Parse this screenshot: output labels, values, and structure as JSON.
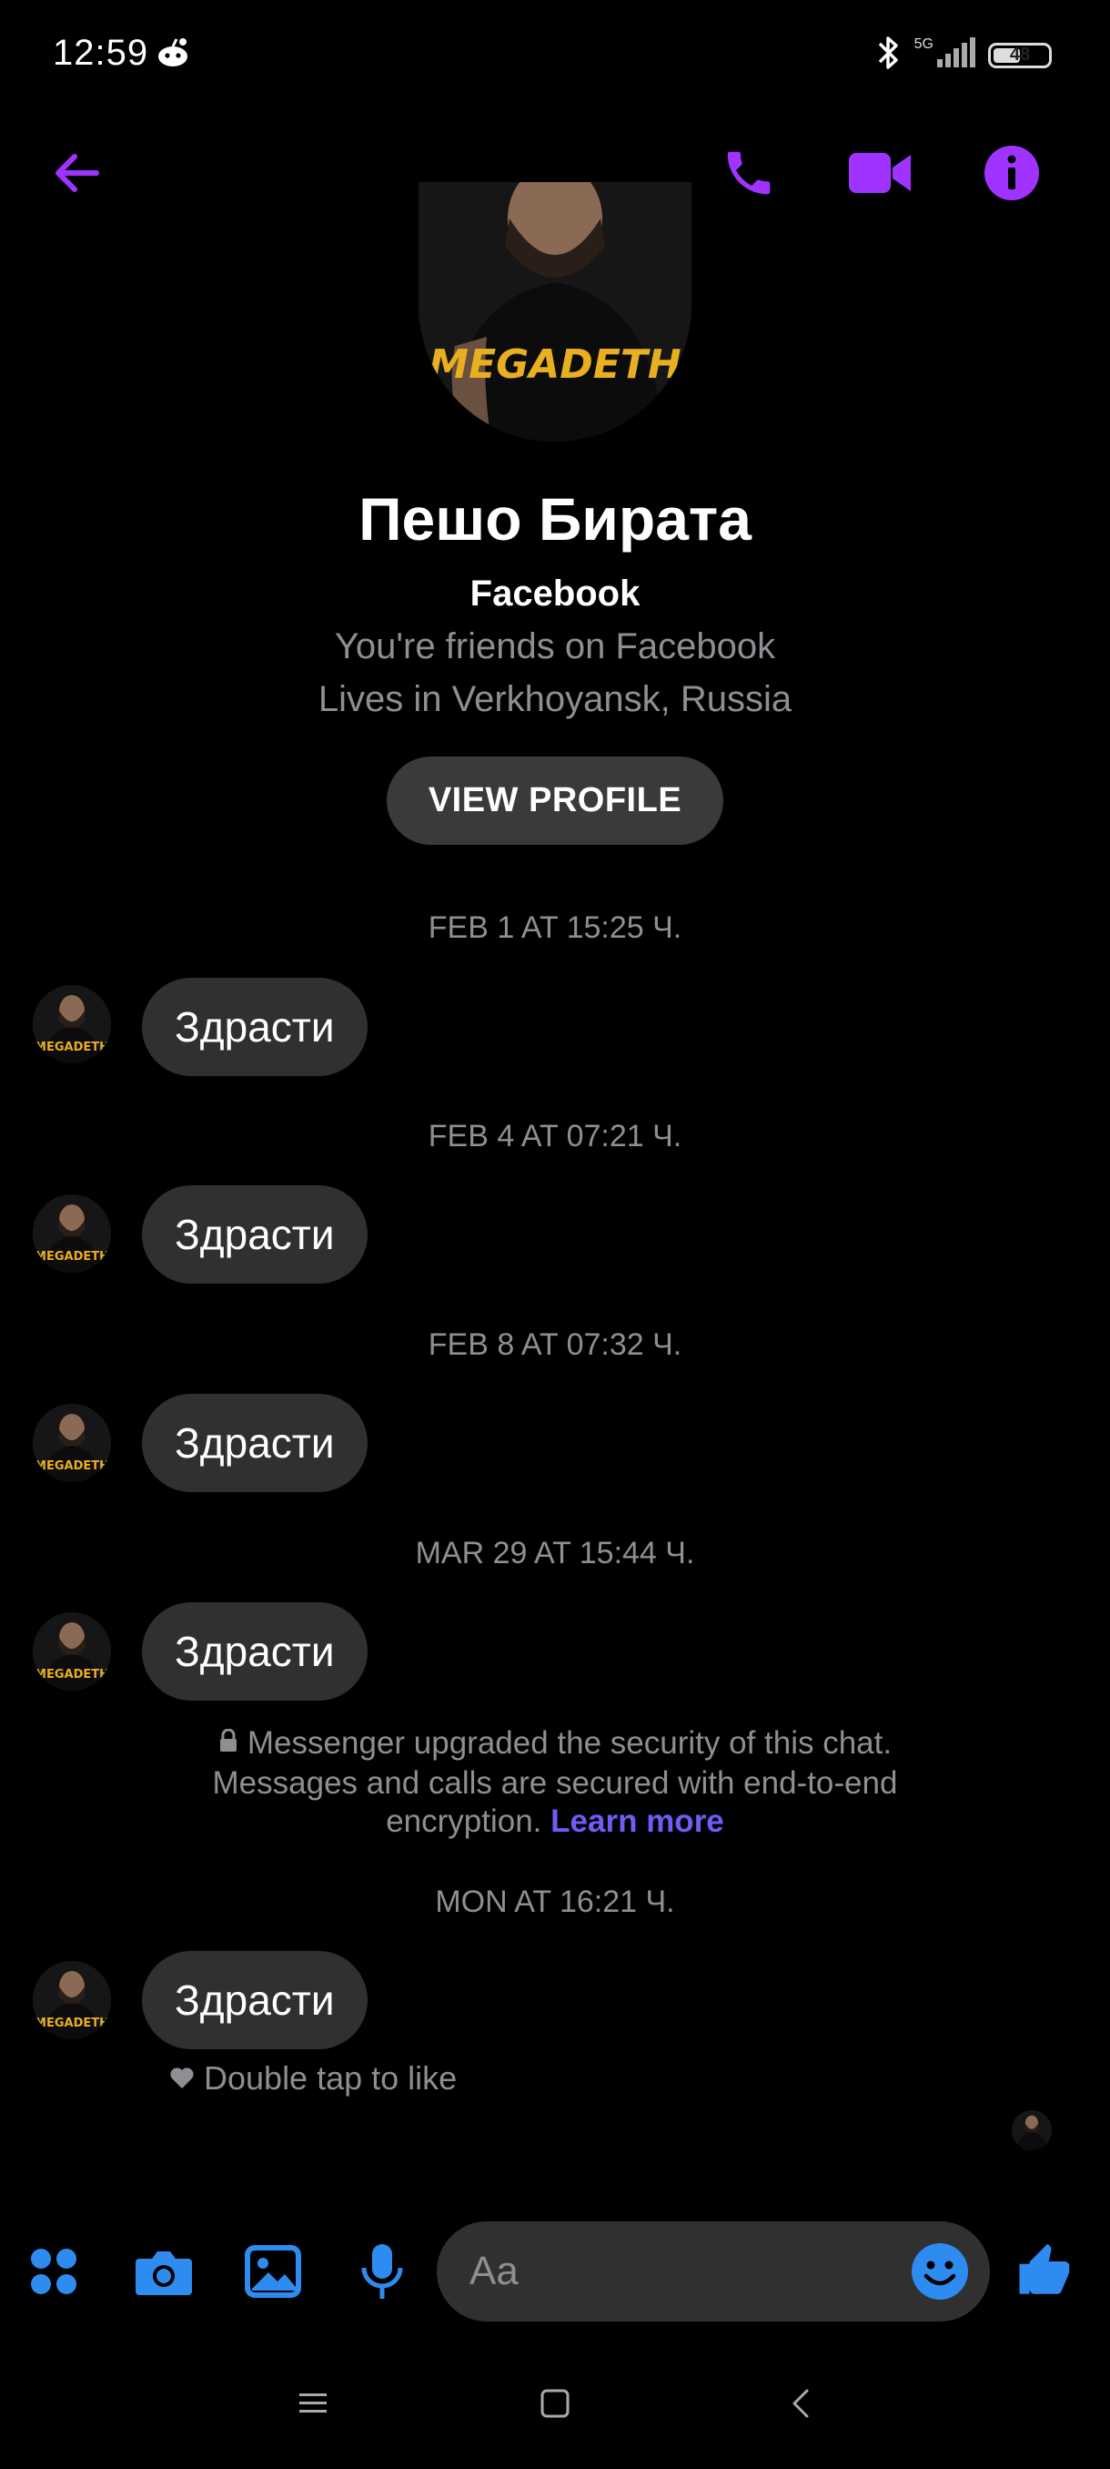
{
  "status_bar": {
    "time": "12:59",
    "network": "5G",
    "battery": "48"
  },
  "top_bar": {
    "back_icon": "arrow-left-icon",
    "call_icon": "phone-icon",
    "video_icon": "video-camera-icon",
    "info_icon": "info-icon",
    "accent_color": "#a033ff"
  },
  "profile": {
    "name": "Пешо Бирата",
    "source": "Facebook",
    "friends_line": "You're friends on Facebook",
    "location_line": "Lives in Verkhoyansk, Russia",
    "view_profile_label": "VIEW PROFILE"
  },
  "conversation": {
    "items": [
      {
        "timestamp": "FEB 1 AT 15:25 Ч.",
        "message": "Здрасти"
      },
      {
        "timestamp": "FEB 4 AT 07:21 Ч.",
        "message": "Здрасти"
      },
      {
        "timestamp": "FEB 8 AT 07:32 Ч.",
        "message": "Здрасти"
      },
      {
        "timestamp": "MAR 29 AT 15:44 Ч.",
        "message": "Здрасти"
      },
      {
        "timestamp": "MON AT 16:21 Ч.",
        "message": "Здрасти"
      }
    ],
    "security_notice": {
      "line1": "Messenger upgraded the security of this chat.",
      "line2": "Messages and calls are secured with end-to-end",
      "line3": "encryption.",
      "learn_more": "Learn more"
    },
    "double_tap_hint": "Double tap to like"
  },
  "composer": {
    "placeholder": "Aa",
    "icons": [
      "apps-grid-icon",
      "camera-icon",
      "gallery-icon",
      "microphone-icon",
      "emoji-icon",
      "thumbs-up-icon"
    ],
    "accent_color": "#2e8bf0"
  },
  "nav_bar": {
    "icons": [
      "menu-icon",
      "home-icon",
      "back-icon"
    ]
  }
}
